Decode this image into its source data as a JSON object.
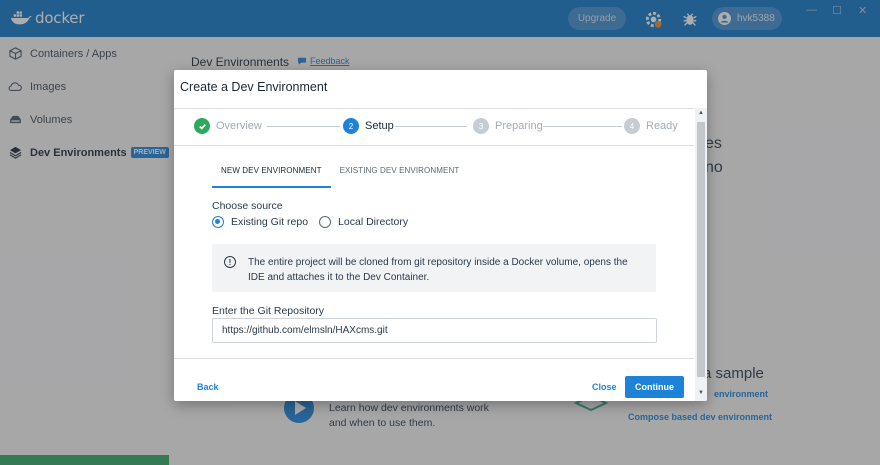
{
  "app": {
    "name": "docker",
    "user": "hvk5388",
    "upgrade_label": "Upgrade"
  },
  "sidebar": {
    "items": [
      {
        "label": "Containers / Apps",
        "icon": "containers-icon"
      },
      {
        "label": "Images",
        "icon": "cloud-icon"
      },
      {
        "label": "Volumes",
        "icon": "volumes-icon"
      },
      {
        "label": "Dev Environments",
        "icon": "dev-environments-icon",
        "badge": "PREVIEW"
      }
    ]
  },
  "main": {
    "title": "Dev Environments",
    "feedback": "Feedback",
    "bg_fragment_1": "es",
    "bg_fragment_2": "no",
    "bg_sample": "a sample",
    "bg_env_link": "environment",
    "bg_compose_link": "Compose based dev environment",
    "bg_learn_1": "Learn how dev environments work",
    "bg_learn_2": "and when to use them."
  },
  "modal": {
    "title": "Create a Dev Environment",
    "steps": [
      {
        "num": "1",
        "label": "Overview",
        "state": "done"
      },
      {
        "num": "2",
        "label": "Setup",
        "state": "current"
      },
      {
        "num": "3",
        "label": "Preparing",
        "state": "pending"
      },
      {
        "num": "4",
        "label": "Ready",
        "state": "pending"
      }
    ],
    "tabs": [
      "NEW DEV ENVIRONMENT",
      "EXISTING DEV ENVIRONMENT"
    ],
    "choose_source": "Choose source",
    "radio_git": "Existing Git repo",
    "radio_local": "Local Directory",
    "info_text": "The entire project will be cloned from git repository inside a Docker volume, opens the IDE and attaches it to the Dev Container.",
    "repo_label": "Enter the Git Repository",
    "repo_value": "https://github.com/elmsln/HAXcms.git",
    "back": "Back",
    "close": "Close",
    "continue": "Continue"
  },
  "colors": {
    "primary": "#1d83d8",
    "topbar": "#0f76c9",
    "success": "#2eaa5e"
  }
}
